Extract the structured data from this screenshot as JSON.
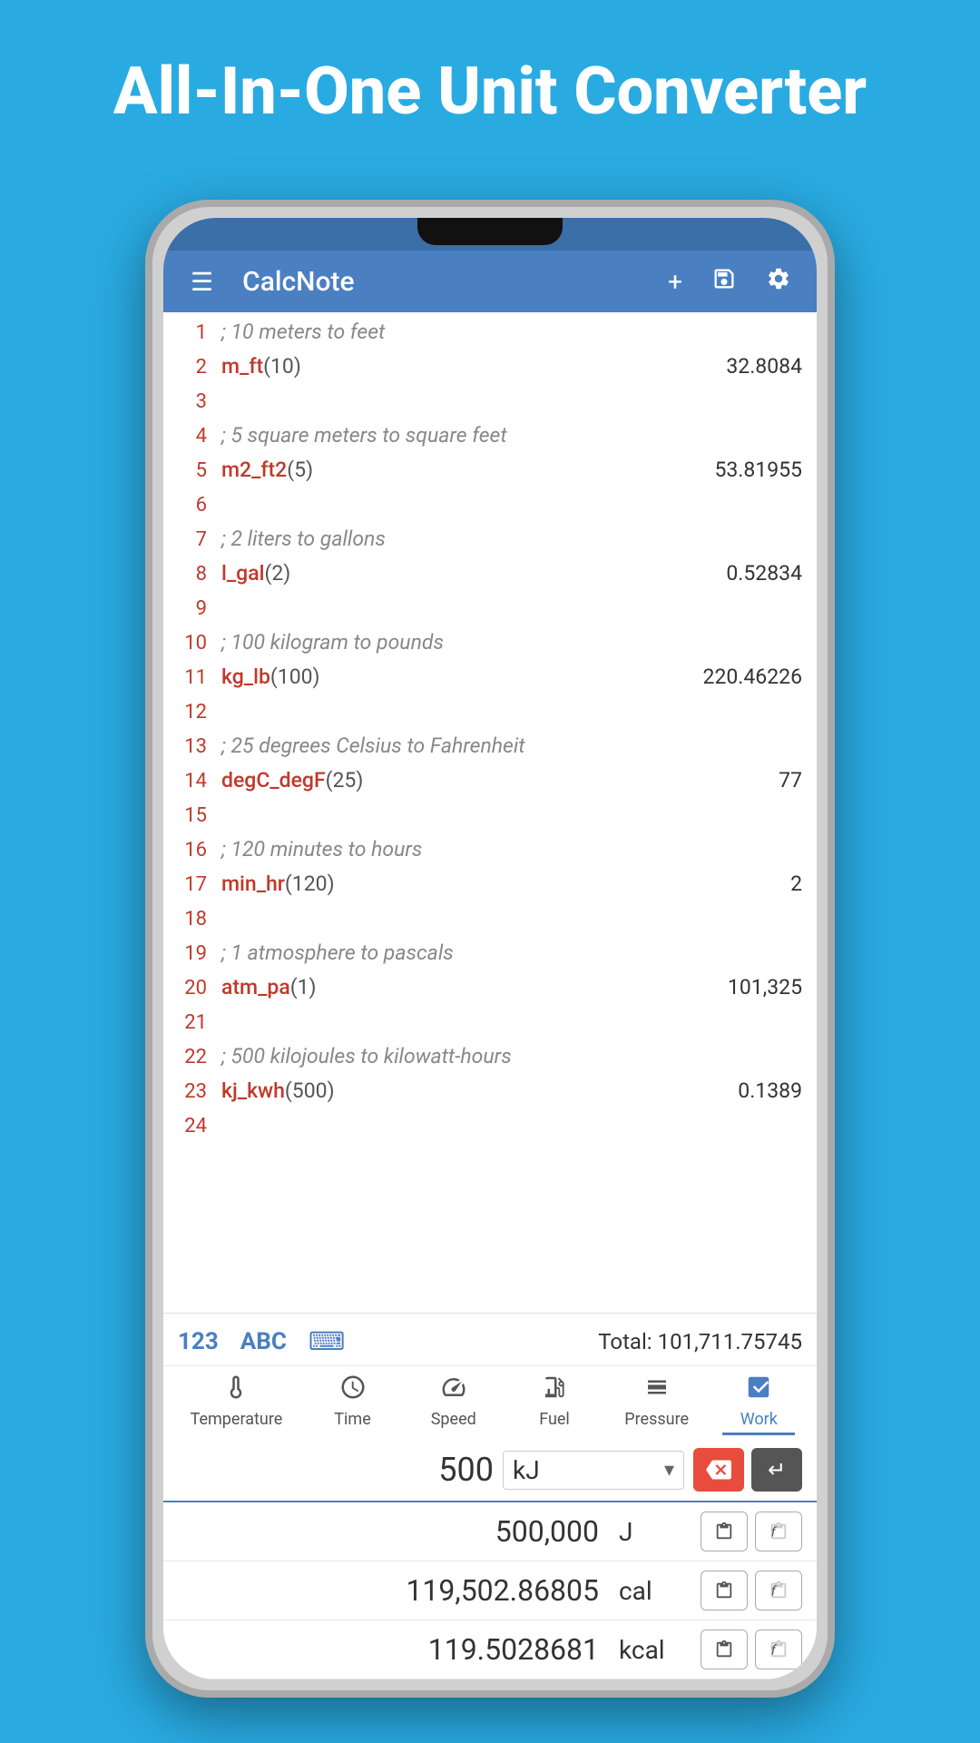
{
  "app": {
    "title": "All-In-One Unit Converter"
  },
  "toolbar": {
    "app_name": "CalcNote",
    "plus_label": "+",
    "save_label": "💾",
    "settings_label": "⚙"
  },
  "editor": {
    "lines": [
      {
        "num": "1",
        "comment": "; 10 meters to feet",
        "code": null,
        "result": null
      },
      {
        "num": "2",
        "comment": null,
        "code": "m_ft(10)",
        "func": "m_ft",
        "args": "(10)",
        "result": "32.8084"
      },
      {
        "num": "3",
        "comment": null,
        "code": null,
        "result": null
      },
      {
        "num": "4",
        "comment": "; 5 square meters to square feet",
        "code": null,
        "result": null
      },
      {
        "num": "5",
        "comment": null,
        "code": "m2_ft2(5)",
        "func": "m2_ft2",
        "args": "(5)",
        "result": "53.81955"
      },
      {
        "num": "6",
        "comment": null,
        "code": null,
        "result": null
      },
      {
        "num": "7",
        "comment": "; 2 liters to gallons",
        "code": null,
        "result": null
      },
      {
        "num": "8",
        "comment": null,
        "code": "l_gal(2)",
        "func": "l_gal",
        "args": "(2)",
        "result": "0.52834"
      },
      {
        "num": "9",
        "comment": null,
        "code": null,
        "result": null
      },
      {
        "num": "10",
        "comment": "; 100 kilogram to pounds",
        "code": null,
        "result": null
      },
      {
        "num": "11",
        "comment": null,
        "code": "kg_lb(100)",
        "func": "kg_lb",
        "args": "(100)",
        "result": "220.46226"
      },
      {
        "num": "12",
        "comment": null,
        "code": null,
        "result": null
      },
      {
        "num": "13",
        "comment": "; 25 degrees Celsius to Fahrenheit",
        "code": null,
        "result": null
      },
      {
        "num": "14",
        "comment": null,
        "code": "degC_degF(25)",
        "func": "degC_degF",
        "args": "(25)",
        "result": "77"
      },
      {
        "num": "15",
        "comment": null,
        "code": null,
        "result": null
      },
      {
        "num": "16",
        "comment": "; 120 minutes to hours",
        "code": null,
        "result": null
      },
      {
        "num": "17",
        "comment": null,
        "code": "min_hr(120)",
        "func": "min_hr",
        "args": "(120)",
        "result": "2"
      },
      {
        "num": "18",
        "comment": null,
        "code": null,
        "result": null
      },
      {
        "num": "19",
        "comment": "; 1 atmosphere to pascals",
        "code": null,
        "result": null
      },
      {
        "num": "20",
        "comment": null,
        "code": "atm_pa(1)",
        "func": "atm_pa",
        "args": "(1)",
        "result": "101,325"
      },
      {
        "num": "21",
        "comment": null,
        "code": null,
        "result": null
      },
      {
        "num": "22",
        "comment": "; 500 kilojoules to kilowatt-hours",
        "code": null,
        "result": null
      },
      {
        "num": "23",
        "comment": null,
        "code": "kj_kwh(500)",
        "func": "kj_kwh",
        "args": "(500)",
        "result": "0.1389"
      },
      {
        "num": "24",
        "comment": null,
        "code": null,
        "result": null
      }
    ]
  },
  "bottom_bar": {
    "tab_123": "123",
    "tab_abc": "ABC",
    "total_label": "Total:",
    "total_value": "101,711.75745"
  },
  "categories": [
    {
      "id": "temperature",
      "label": "Temperature",
      "icon": "🌡"
    },
    {
      "id": "time",
      "label": "Time",
      "icon": "⏱"
    },
    {
      "id": "speed",
      "label": "Speed",
      "icon": "⏱"
    },
    {
      "id": "fuel",
      "label": "Fuel",
      "icon": "⛽"
    },
    {
      "id": "pressure",
      "label": "Pressure",
      "icon": "⬇"
    },
    {
      "id": "work",
      "label": "Work",
      "icon": "➡",
      "active": true
    }
  ],
  "converter": {
    "input_value": "500",
    "input_unit": "kJ",
    "results": [
      {
        "value": "500,000",
        "unit": "J"
      },
      {
        "value": "119,502.86805",
        "unit": "cal"
      },
      {
        "value": "119.5028681",
        "unit": "kcal"
      }
    ]
  }
}
